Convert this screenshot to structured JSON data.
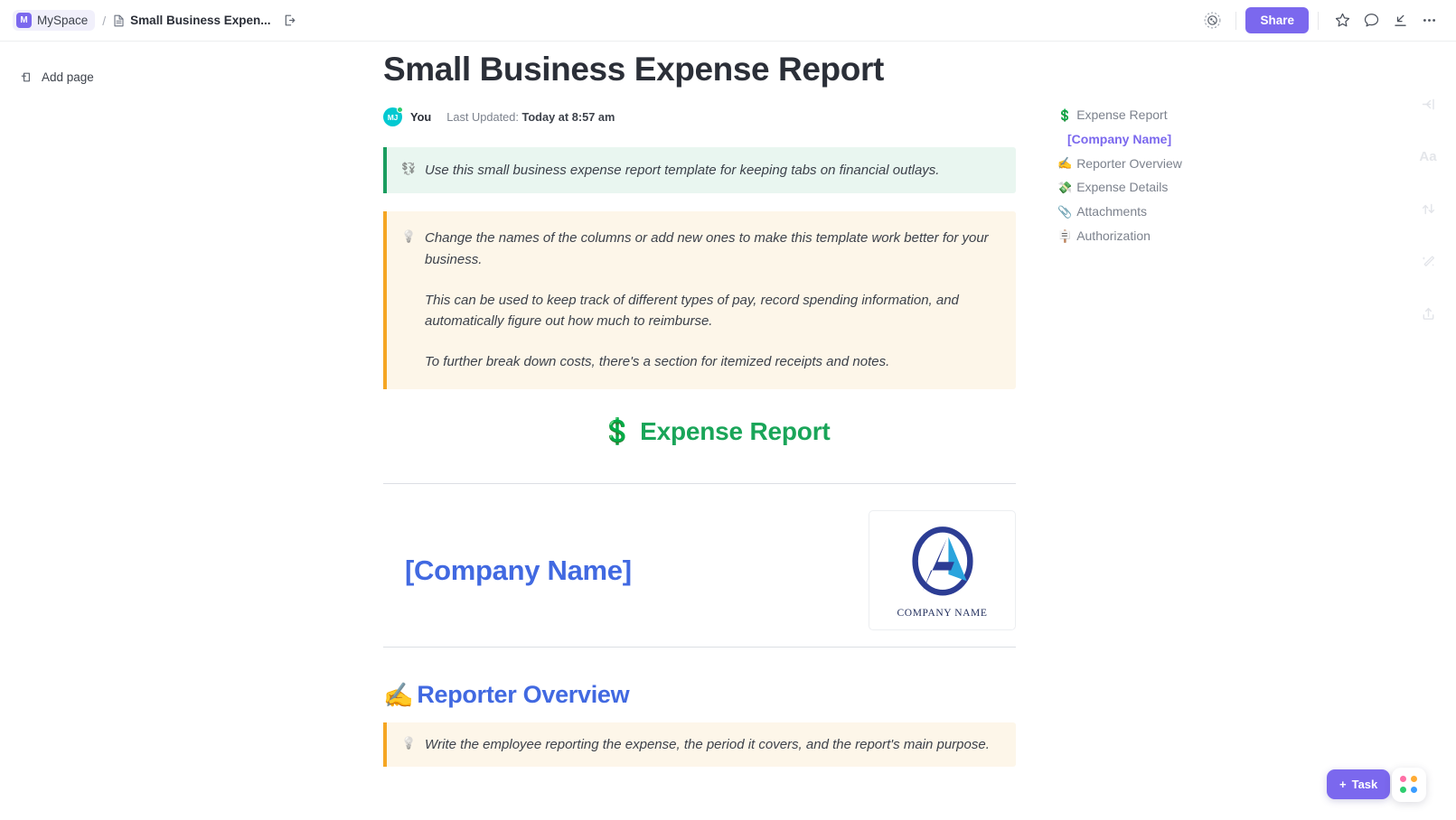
{
  "topbar": {
    "space_badge": "M",
    "space_name": "MySpace",
    "separator": "/",
    "doc_icon": "document-icon",
    "doc_name": "Small Business Expen...",
    "open_icon": "open-in-new-icon",
    "privacy_icon": "privacy-toggle-icon",
    "share_label": "Share",
    "star_icon": "star-icon",
    "comment_icon": "comment-icon",
    "download_icon": "download-icon",
    "more_icon": "ellipsis-icon"
  },
  "sidebar": {
    "add_page_icon": "add-page-icon",
    "add_page_label": "Add page"
  },
  "document": {
    "title": "Small Business Expense Report",
    "author": "You",
    "updated_prefix": "Last Updated:",
    "updated_value": "Today at 8:57 am",
    "avatar_initials": "MJ",
    "callout_green": {
      "icon": "💱",
      "text": "Use this small business expense report template for keeping tabs on financial outlays."
    },
    "callout_amber": {
      "icon": "💡",
      "paragraphs": [
        "Change the names of the columns or add new ones to make this template work better for your business.",
        "This can be used to keep track of different types of pay, record spending information, and automatically figure out how much to reimburse.",
        "To further break down costs, there's a section for itemized receipts and notes."
      ]
    },
    "heading_expense": {
      "emoji": "💲",
      "text": "Expense Report",
      "color": "#1aa559"
    },
    "company_name": "[Company Name]",
    "logo": {
      "caption": "COMPANY NAME",
      "ring_color": "#2c3d94",
      "accent_color": "#2aa4dd"
    },
    "heading_reporter": {
      "emoji": "✍️",
      "text": "Reporter Overview",
      "color": "#4169e1"
    },
    "callout_reporter": {
      "icon": "💡",
      "text": "Write the employee reporting the expense, the period it covers, and the report's main purpose."
    }
  },
  "outline": {
    "items": [
      {
        "emoji": "💲",
        "label": "Expense Report",
        "active": false
      },
      {
        "emoji": "",
        "label": "[Company Name]",
        "active": true
      },
      {
        "emoji": "✍️",
        "label": "Reporter Overview",
        "active": false
      },
      {
        "emoji": "💸",
        "label": "Expense Details",
        "active": false
      },
      {
        "emoji": "📎",
        "label": "Attachments",
        "active": false
      },
      {
        "emoji": "🪧",
        "label": "Authorization",
        "active": false
      }
    ]
  },
  "rail": {
    "items": [
      {
        "icon": "collapse-panel-icon",
        "glyph": "←|"
      },
      {
        "icon": "font-size-icon",
        "glyph": "Aa"
      },
      {
        "icon": "relationships-icon",
        "glyph": "⇅"
      },
      {
        "icon": "ai-wand-icon",
        "glyph": "✧"
      },
      {
        "icon": "share-export-icon",
        "glyph": "⇧"
      }
    ]
  },
  "floating": {
    "task_plus": "+",
    "task_label": "Task",
    "apps_icon": "apps-grid-icon",
    "apps_dots": [
      "#ff6fa5",
      "#ffab33",
      "#2ecd6f",
      "#3b9dff"
    ]
  }
}
